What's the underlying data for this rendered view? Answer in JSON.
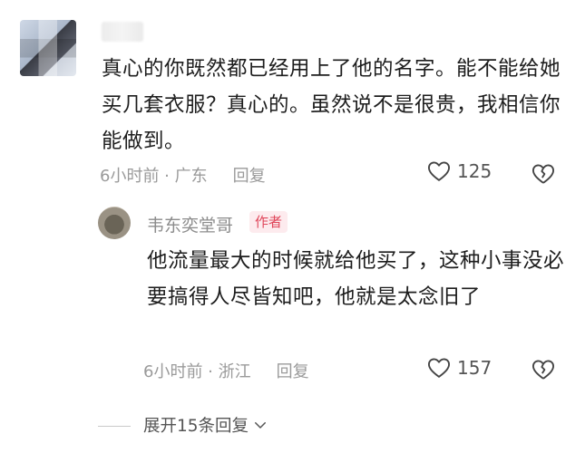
{
  "comment": {
    "text": "真心的你既然都已经用上了他的名字。能不能给她买几套衣服？真心的。虽然说不是很贵，我相信你能做到。",
    "time_location": "6小时前 · 广东",
    "reply_label": "回复",
    "likes": "125"
  },
  "reply": {
    "author": "韦东奕堂哥",
    "badge": "作者",
    "text": "他流量最大的时候就给他买了，这种小事没必要搞得人尽皆知吧，他就是太念旧了",
    "time_location": "6小时前 · 浙江",
    "reply_label": "回复",
    "likes": "157"
  },
  "expand_label": "展开15条回复"
}
